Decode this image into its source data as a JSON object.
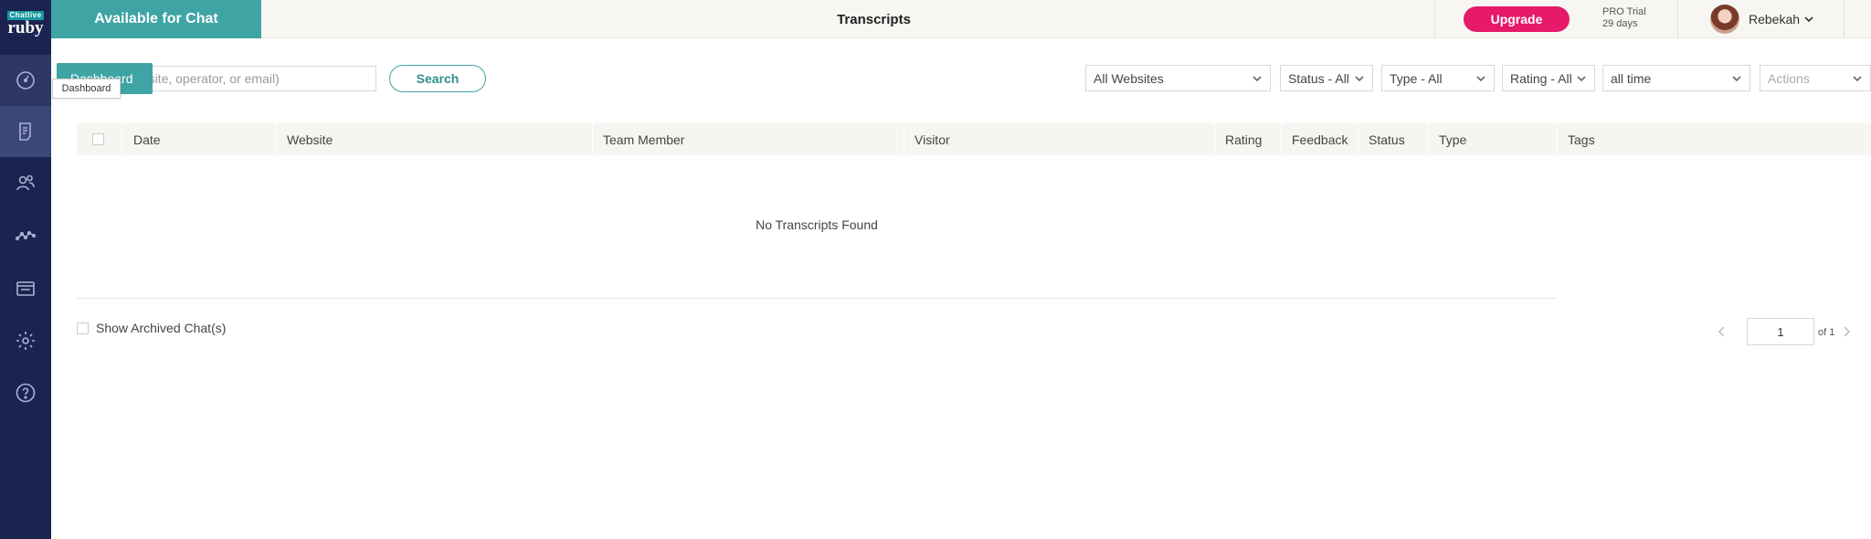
{
  "sidebar": {
    "logo": {
      "top": "Chatlive",
      "main": "ruby"
    },
    "items": [
      {
        "icon": "speedometer-icon"
      },
      {
        "icon": "transcript-icon"
      },
      {
        "icon": "users-icon"
      },
      {
        "icon": "analytics-icon"
      },
      {
        "icon": "widget-icon"
      },
      {
        "icon": "gear-icon"
      },
      {
        "icon": "help-icon"
      }
    ]
  },
  "topbar": {
    "status_button": "Available for Chat",
    "title": "Transcripts",
    "upgrade": "Upgrade",
    "trial_line1": "PRO Trial",
    "trial_line2": "29 days",
    "user_name": "Rebekah"
  },
  "search": {
    "dashboard_badge": "Dashboard",
    "tooltip": "Dashboard",
    "placeholder": "ebsite, operator, or email)",
    "button": "Search"
  },
  "filters": {
    "websites": "All Websites",
    "status": "Status - All",
    "type": "Type - All",
    "rating": "Rating - All",
    "time": "all time",
    "actions": "Actions"
  },
  "table": {
    "columns": [
      "Date",
      "Website",
      "Team Member",
      "Visitor",
      "Rating",
      "Feedback",
      "Status",
      "Type",
      "Tags"
    ],
    "empty_message": "No Transcripts Found"
  },
  "footer": {
    "archived_label": "Show Archived Chat(s)",
    "page_value": "1",
    "page_of": "of 1"
  }
}
